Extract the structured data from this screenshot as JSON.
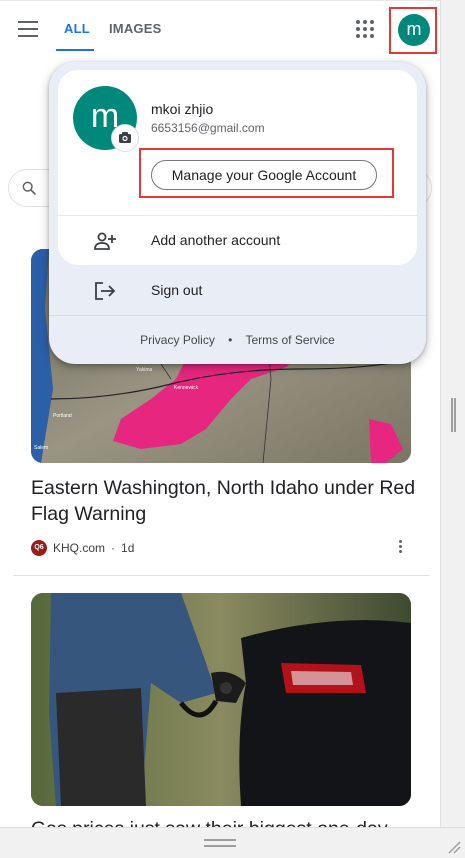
{
  "header": {
    "tabs": [
      {
        "label": "ALL",
        "active": true
      },
      {
        "label": "IMAGES",
        "active": false
      }
    ],
    "avatar_initial": "m"
  },
  "account_menu": {
    "avatar_initial": "m",
    "name": "mkoi zhjio",
    "email": "6653156@gmail.com",
    "manage_label": "Manage your Google Account",
    "add_account_label": "Add another account",
    "sign_out_label": "Sign out",
    "privacy_label": "Privacy Policy",
    "separator": "•",
    "terms_label": "Terms of Service"
  },
  "feed": {
    "articles": [
      {
        "headline": "Eastern Washington, North Idaho under Red Flag Warning",
        "source": "KHQ.com",
        "age": "1d",
        "logo_text": "Q6",
        "map_labels": [
          "Yakima",
          "Kennewick",
          "Portland",
          "Salem"
        ]
      },
      {
        "headline": "Gas prices just saw their biggest one-day"
      }
    ],
    "source_separator": "·"
  },
  "colors": {
    "accent": "#1a73e8",
    "avatar": "#00897b",
    "highlight": "#e53935",
    "popup_bg": "#e9eef6",
    "warning_area": "#e6267f"
  },
  "icons": [
    "menu-icon",
    "apps-icon",
    "search-icon",
    "camera-icon",
    "add-person-icon",
    "sign-out-icon",
    "more-vert-icon"
  ]
}
